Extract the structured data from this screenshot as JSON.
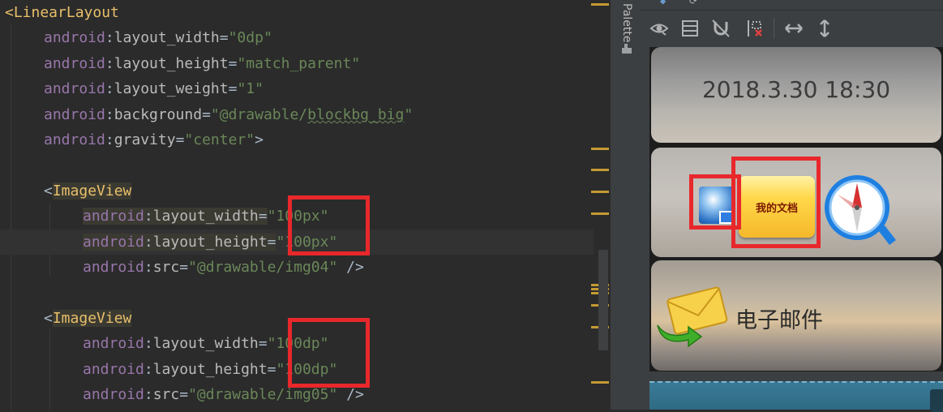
{
  "editor": {
    "lines": [
      {
        "indent": 0,
        "parts": [
          [
            "tag",
            "<LinearLayout"
          ]
        ]
      },
      {
        "indent": 1,
        "parts": [
          [
            "ns",
            "android"
          ],
          [
            "punct",
            ":"
          ],
          [
            "attr",
            "layout_width"
          ],
          [
            "punct",
            "="
          ],
          [
            "val",
            "\"0dp\""
          ]
        ]
      },
      {
        "indent": 1,
        "parts": [
          [
            "ns",
            "android"
          ],
          [
            "punct",
            ":"
          ],
          [
            "attr",
            "layout_height"
          ],
          [
            "punct",
            "="
          ],
          [
            "val",
            "\"match_parent\""
          ]
        ]
      },
      {
        "indent": 1,
        "parts": [
          [
            "ns",
            "android"
          ],
          [
            "punct",
            ":"
          ],
          [
            "attr",
            "layout_weight"
          ],
          [
            "punct",
            "="
          ],
          [
            "val",
            "\"1\""
          ]
        ]
      },
      {
        "indent": 1,
        "parts": [
          [
            "ns",
            "android"
          ],
          [
            "punct",
            ":"
          ],
          [
            "attr",
            "background"
          ],
          [
            "punct",
            "="
          ],
          [
            "val",
            "\"@drawable/"
          ],
          [
            "valw",
            "blockbg_big"
          ],
          [
            "val",
            "\""
          ]
        ]
      },
      {
        "indent": 1,
        "parts": [
          [
            "ns",
            "android"
          ],
          [
            "punct",
            ":"
          ],
          [
            "attr",
            "gravity"
          ],
          [
            "punct",
            "="
          ],
          [
            "val",
            "\"center\""
          ],
          [
            "punct",
            ">"
          ]
        ]
      },
      {
        "indent": 0,
        "parts": []
      },
      {
        "indent": 1,
        "parts": [
          [
            "punct",
            "<"
          ],
          [
            "taghl",
            "ImageView"
          ]
        ]
      },
      {
        "indent": 2,
        "hl": true,
        "parts": [
          [
            "ns",
            "android"
          ],
          [
            "punct",
            ":"
          ],
          [
            "attr",
            "layout_width"
          ],
          [
            "punct",
            "="
          ],
          [
            "val",
            "\"100px\""
          ]
        ]
      },
      {
        "indent": 2,
        "hl": true,
        "current": true,
        "parts": [
          [
            "ns",
            "android"
          ],
          [
            "punct",
            ":"
          ],
          [
            "attr",
            "layout_height"
          ],
          [
            "punct",
            "="
          ],
          [
            "val",
            "\"100px\""
          ]
        ]
      },
      {
        "indent": 2,
        "parts": [
          [
            "ns",
            "android"
          ],
          [
            "punct",
            ":"
          ],
          [
            "attr",
            "src"
          ],
          [
            "punct",
            "="
          ],
          [
            "val",
            "\"@drawable/img04\""
          ],
          [
            "punct",
            " />"
          ]
        ]
      },
      {
        "indent": 0,
        "parts": []
      },
      {
        "indent": 1,
        "parts": [
          [
            "punct",
            "<"
          ],
          [
            "taghl",
            "ImageView"
          ]
        ]
      },
      {
        "indent": 2,
        "parts": [
          [
            "ns",
            "android"
          ],
          [
            "punct",
            ":"
          ],
          [
            "attr",
            "layout_width"
          ],
          [
            "punct",
            "="
          ],
          [
            "val",
            "\"100dp\""
          ]
        ]
      },
      {
        "indent": 2,
        "parts": [
          [
            "ns",
            "android"
          ],
          [
            "punct",
            ":"
          ],
          [
            "attr",
            "layout_height"
          ],
          [
            "punct",
            "="
          ],
          [
            "val",
            "\"100dp\""
          ]
        ]
      },
      {
        "indent": 2,
        "parts": [
          [
            "ns",
            "android"
          ],
          [
            "punct",
            ":"
          ],
          [
            "attr",
            "src"
          ],
          [
            "punct",
            "="
          ],
          [
            "val",
            "\"@drawable/img05\""
          ],
          [
            "punct",
            " />"
          ]
        ]
      }
    ]
  },
  "palette": {
    "label": "Palette"
  },
  "toolbar": {
    "icons": [
      "eye-icon",
      "layout-bounds-icon",
      "no-magnet-icon",
      "clear-constraints-icon",
      "expand-horizontal-icon",
      "expand-vertical-icon"
    ]
  },
  "preview": {
    "time_text": "2018.3.30 18:30",
    "doc_button_text": "我的文档",
    "email_label": "电子邮件"
  },
  "colors": {
    "highlight_box": "#e8282b",
    "editor_bg": "#2b2b2b",
    "panel_bg": "#3c3f41"
  }
}
